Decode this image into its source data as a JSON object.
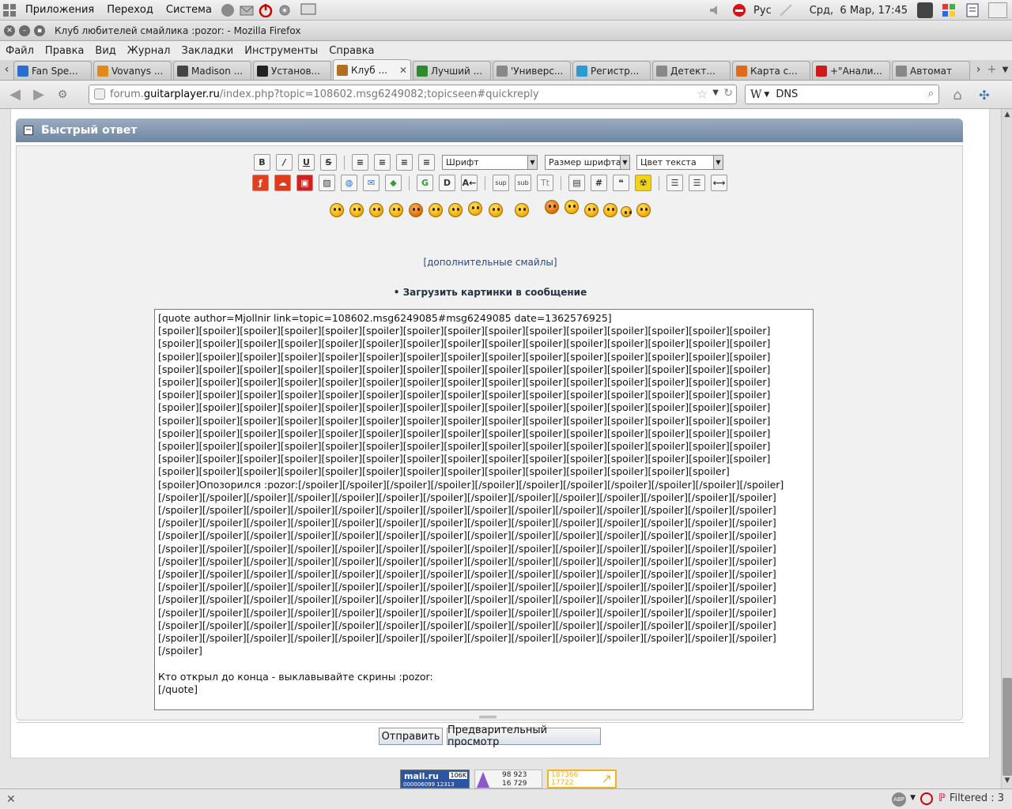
{
  "panel": {
    "menus": [
      "Приложения",
      "Переход",
      "Система"
    ],
    "keyboard_layout": "Рус",
    "clock": "Срд,  6 Мар, 17:45"
  },
  "window": {
    "title": "Клуб любителей смайлика :pozor: - Mozilla Firefox"
  },
  "menubar": [
    "Файл",
    "Правка",
    "Вид",
    "Журнал",
    "Закладки",
    "Инструменты",
    "Справка"
  ],
  "tabs": [
    {
      "label": "Fan Spe...",
      "color": "#2a6fd0"
    },
    {
      "label": "Vovanys ...",
      "color": "#e08a1a"
    },
    {
      "label": "Madison ...",
      "color": "#444444"
    },
    {
      "label": "Установ...",
      "color": "#222222"
    },
    {
      "label": "Клуб ...",
      "color": "#b07020",
      "active": true
    },
    {
      "label": "Лучший ...",
      "color": "#2d8a2d"
    },
    {
      "label": "'Универс...",
      "color": "#888888"
    },
    {
      "label": "Регистр...",
      "color": "#2a9ad0"
    },
    {
      "label": "Детект...",
      "color": "#888888"
    },
    {
      "label": "Карта с...",
      "color": "#e06a1a"
    },
    {
      "label": "+\"Анали...",
      "color": "#d01a1a"
    },
    {
      "label": "Автомат",
      "color": "#888888"
    }
  ],
  "navbar": {
    "url_prefix": "forum.",
    "url_host": "guitarplayer.ru",
    "url_path": "/index.php?topic=108602.msg6249082;topicseen#quickreply",
    "search_engine": "W",
    "search_value": "DNS"
  },
  "quick_reply": {
    "title": "Быстрый ответ",
    "font_select": "Шрифт",
    "size_select": "Размер шрифта",
    "color_select": "Цвет текста",
    "more_smileys": "[дополнительные смайлы]",
    "upload_images": "• Загрузить картинки в сообщение",
    "message_lines": [
      "[quote author=Mjollnir link=topic=108602.msg6249085#msg6249085 date=1362576925]",
      "[spoiler][spoiler][spoiler][spoiler][spoiler][spoiler][spoiler][spoiler][spoiler][spoiler][spoiler][spoiler][spoiler][spoiler][spoiler]",
      "[spoiler][spoiler][spoiler][spoiler][spoiler][spoiler][spoiler][spoiler][spoiler][spoiler][spoiler][spoiler][spoiler][spoiler][spoiler]",
      "[spoiler][spoiler][spoiler][spoiler][spoiler][spoiler][spoiler][spoiler][spoiler][spoiler][spoiler][spoiler][spoiler][spoiler][spoiler]",
      "[spoiler][spoiler][spoiler][spoiler][spoiler][spoiler][spoiler][spoiler][spoiler][spoiler][spoiler][spoiler][spoiler][spoiler][spoiler]",
      "[spoiler][spoiler][spoiler][spoiler][spoiler][spoiler][spoiler][spoiler][spoiler][spoiler][spoiler][spoiler][spoiler][spoiler][spoiler]",
      "[spoiler][spoiler][spoiler][spoiler][spoiler][spoiler][spoiler][spoiler][spoiler][spoiler][spoiler][spoiler][spoiler][spoiler][spoiler]",
      "[spoiler][spoiler][spoiler][spoiler][spoiler][spoiler][spoiler][spoiler][spoiler][spoiler][spoiler][spoiler][spoiler][spoiler][spoiler]",
      "[spoiler][spoiler][spoiler][spoiler][spoiler][spoiler][spoiler][spoiler][spoiler][spoiler][spoiler][spoiler][spoiler][spoiler][spoiler]",
      "[spoiler][spoiler][spoiler][spoiler][spoiler][spoiler][spoiler][spoiler][spoiler][spoiler][spoiler][spoiler][spoiler][spoiler][spoiler]",
      "[spoiler][spoiler][spoiler][spoiler][spoiler][spoiler][spoiler][spoiler][spoiler][spoiler][spoiler][spoiler][spoiler][spoiler][spoiler]",
      "[spoiler][spoiler][spoiler][spoiler][spoiler][spoiler][spoiler][spoiler][spoiler][spoiler][spoiler][spoiler][spoiler][spoiler][spoiler]",
      "[spoiler][spoiler][spoiler][spoiler][spoiler][spoiler][spoiler][spoiler][spoiler][spoiler][spoiler][spoiler][spoiler][spoiler]",
      "[spoiler]Опозорился :pozor:[/spoiler][/spoiler][/spoiler][/spoiler][/spoiler][/spoiler][/spoiler][/spoiler][/spoiler][/spoiler][/spoiler]",
      "[/spoiler][/spoiler][/spoiler][/spoiler][/spoiler][/spoiler][/spoiler][/spoiler][/spoiler][/spoiler][/spoiler][/spoiler][/spoiler][/spoiler]",
      "[/spoiler][/spoiler][/spoiler][/spoiler][/spoiler][/spoiler][/spoiler][/spoiler][/spoiler][/spoiler][/spoiler][/spoiler][/spoiler][/spoiler]",
      "[/spoiler][/spoiler][/spoiler][/spoiler][/spoiler][/spoiler][/spoiler][/spoiler][/spoiler][/spoiler][/spoiler][/spoiler][/spoiler][/spoiler]",
      "[/spoiler][/spoiler][/spoiler][/spoiler][/spoiler][/spoiler][/spoiler][/spoiler][/spoiler][/spoiler][/spoiler][/spoiler][/spoiler][/spoiler]",
      "[/spoiler][/spoiler][/spoiler][/spoiler][/spoiler][/spoiler][/spoiler][/spoiler][/spoiler][/spoiler][/spoiler][/spoiler][/spoiler][/spoiler]",
      "[/spoiler][/spoiler][/spoiler][/spoiler][/spoiler][/spoiler][/spoiler][/spoiler][/spoiler][/spoiler][/spoiler][/spoiler][/spoiler][/spoiler]",
      "[/spoiler][/spoiler][/spoiler][/spoiler][/spoiler][/spoiler][/spoiler][/spoiler][/spoiler][/spoiler][/spoiler][/spoiler][/spoiler][/spoiler]",
      "[/spoiler][/spoiler][/spoiler][/spoiler][/spoiler][/spoiler][/spoiler][/spoiler][/spoiler][/spoiler][/spoiler][/spoiler][/spoiler][/spoiler]",
      "[/spoiler][/spoiler][/spoiler][/spoiler][/spoiler][/spoiler][/spoiler][/spoiler][/spoiler][/spoiler][/spoiler][/spoiler][/spoiler][/spoiler]",
      "[/spoiler][/spoiler][/spoiler][/spoiler][/spoiler][/spoiler][/spoiler][/spoiler][/spoiler][/spoiler][/spoiler][/spoiler][/spoiler][/spoiler]",
      "[/spoiler][/spoiler][/spoiler][/spoiler][/spoiler][/spoiler][/spoiler][/spoiler][/spoiler][/spoiler][/spoiler][/spoiler][/spoiler][/spoiler]",
      "[/spoiler][/spoiler][/spoiler][/spoiler][/spoiler][/spoiler][/spoiler][/spoiler][/spoiler][/spoiler][/spoiler][/spoiler][/spoiler][/spoiler]",
      "[/spoiler]",
      "",
      "Кто открыл до конца - выклавывайте скрины :pozor:",
      "[/quote]"
    ],
    "submit_label": "Отправить",
    "preview_label": "Предварительный просмотр"
  },
  "counters": {
    "mailru": "mail.ru",
    "mailru_count": "106K",
    "mailru_digits": "000006099 12313",
    "stat1": "98 923",
    "stat2": "16 729",
    "li_top": "187366",
    "li_bottom": "17722"
  },
  "statusbar": {
    "filter": "Filtered : 3"
  }
}
